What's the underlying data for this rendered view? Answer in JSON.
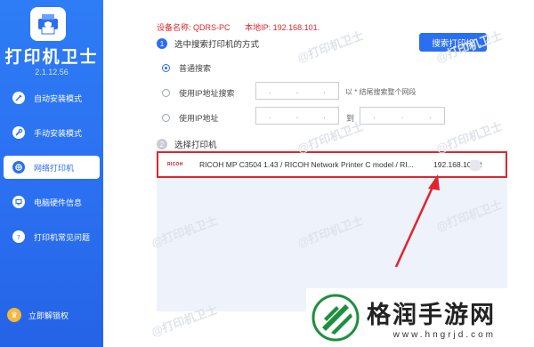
{
  "sidebar": {
    "title": "打印机卫士",
    "version": "2.1.12.56",
    "items": [
      {
        "label": "自动安装模式",
        "icon": "magic-icon"
      },
      {
        "label": "手动安装模式",
        "icon": "wrench-icon"
      },
      {
        "label": "网络打印机",
        "icon": "network-icon"
      },
      {
        "label": "电脑硬件信息",
        "icon": "hardware-icon"
      },
      {
        "label": "打印机常见问题",
        "icon": "question-icon"
      }
    ],
    "active_index": 2,
    "vip_label": "立即解锁权"
  },
  "device": {
    "name_label": "设备名称:",
    "name_value": "QDRS-PC",
    "ip_label": "本地IP:",
    "ip_value": "192.168.101."
  },
  "step1": {
    "num": "1",
    "label": "选中搜索打印机的方式"
  },
  "search_button": "搜索打印机",
  "options": [
    {
      "label": "普通搜索",
      "selected": true
    },
    {
      "label": "使用IP地址搜索",
      "selected": false
    },
    {
      "label": "使用IP地址",
      "selected": false
    }
  ],
  "ip_hint": "以 * 结尾搜索整个网段",
  "range_to": "到",
  "ip_dots": ".",
  "step2": {
    "num": "2",
    "label": "选择打印机"
  },
  "printer": {
    "brand": "RICOH",
    "name": "RICOH MP C3504 1.43 / RICOH Network Printer C model / RI...",
    "ip": "192.168.101.2"
  },
  "watermark_text": "@打印机卫士",
  "site": {
    "name": "格润手游网",
    "url": "www.hngrjd.com"
  },
  "colors": {
    "primary": "#2a6ff0",
    "highlight": "#e0242b"
  }
}
